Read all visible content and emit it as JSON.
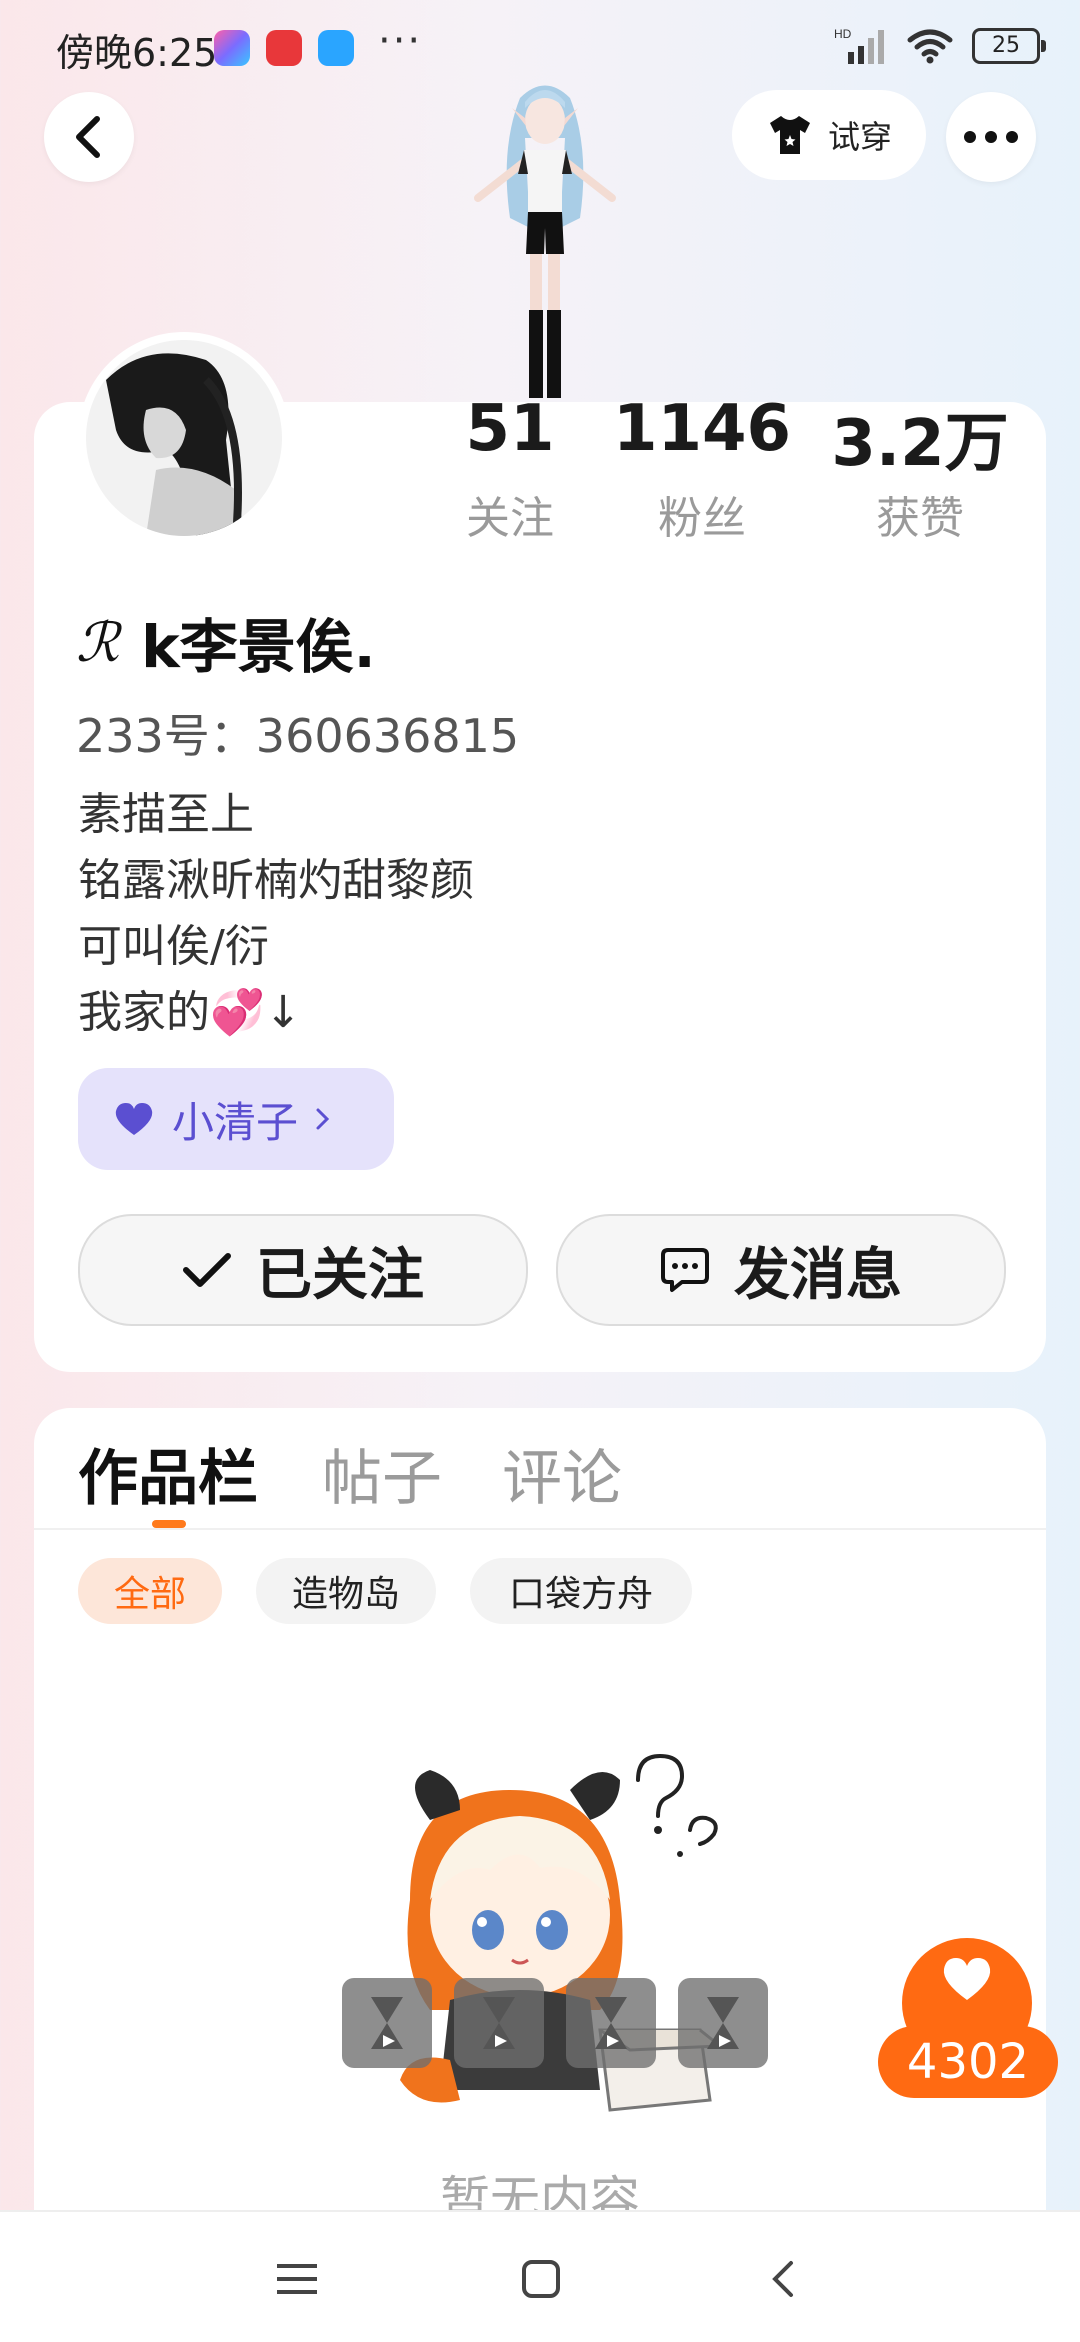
{
  "status_bar": {
    "time": "傍晚6:25",
    "dots": "···",
    "network": "HD",
    "battery": "25"
  },
  "header": {
    "back_icon": "chevron-left-icon",
    "tryon_label": "试穿",
    "more_icon": "more-dots-icon"
  },
  "profile": {
    "stats": [
      {
        "value": "51",
        "label": "关注"
      },
      {
        "value": "1146",
        "label": "粉丝"
      },
      {
        "value": "3.2万",
        "label": "获赞"
      }
    ],
    "name_prefix": "ℛ",
    "name": "k李景俟.",
    "uid": "233号：360636815",
    "bio": [
      "素描至上",
      "铭露湫昕楠灼甜黎颜",
      "可叫俟/衍",
      "我家的💞↓"
    ],
    "chip_label": "小清子",
    "follow_label": "已关注",
    "message_label": "发消息"
  },
  "tabs": {
    "items": [
      "作品栏",
      "帖子",
      "评论"
    ],
    "active": "作品栏"
  },
  "filters": {
    "items": [
      "全部",
      "造物岛",
      "口袋方舟"
    ],
    "active": "全部"
  },
  "empty": {
    "text": "暂无内容"
  },
  "like": {
    "count": "4302"
  },
  "colors": {
    "accent": "#ff6a12",
    "chip_bg": "#e5e2fb",
    "chip_text": "#5b4fd1"
  }
}
